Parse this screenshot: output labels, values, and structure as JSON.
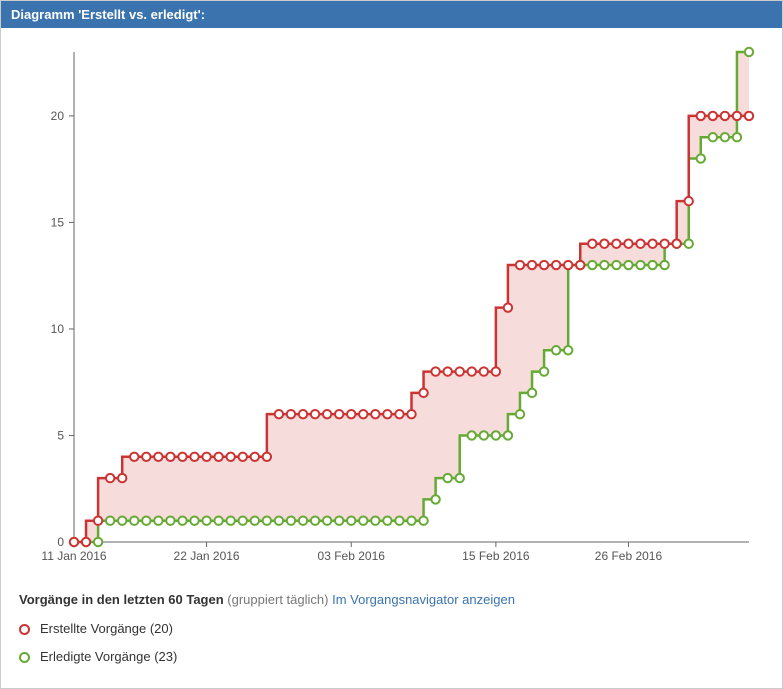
{
  "header": {
    "title": "Diagramm 'Erstellt vs. erledigt':"
  },
  "footer": {
    "line1_bold": "Vorgänge in den letzten 60 Tagen",
    "line1_muted": "(gruppiert täglich)",
    "link_text": "Im Vorgangsnavigator anzeigen",
    "legend_created": "Erstellte Vorgänge (20)",
    "legend_resolved": "Erledigte Vorgänge (23)"
  },
  "chart_data": {
    "type": "line",
    "title": "Erstellt vs. erledigt",
    "xlabel": "",
    "ylabel": "",
    "ylim": [
      0,
      23
    ],
    "y_ticks": [
      0,
      5,
      10,
      15,
      20
    ],
    "x_tick_labels": [
      "11 Jan 2016",
      "22 Jan 2016",
      "03 Feb 2016",
      "15 Feb 2016",
      "26 Feb 2016"
    ],
    "x_tick_index": [
      0,
      11,
      23,
      35,
      46
    ],
    "categories_count": 57,
    "series": [
      {
        "name": "Erstellte Vorgänge",
        "color": "#cc3333",
        "fill_between": true,
        "values": [
          0,
          0,
          1,
          3,
          3,
          4,
          4,
          4,
          4,
          4,
          4,
          4,
          4,
          4,
          4,
          4,
          4,
          6,
          6,
          6,
          6,
          6,
          6,
          6,
          6,
          6,
          6,
          6,
          6,
          7,
          8,
          8,
          8,
          8,
          8,
          8,
          11,
          13,
          13,
          13,
          13,
          13,
          13,
          14,
          14,
          14,
          14,
          14,
          14,
          14,
          14,
          16,
          20,
          20,
          20,
          20,
          20
        ]
      },
      {
        "name": "Erledigte Vorgänge",
        "color": "#66aa33",
        "fill_between": false,
        "values": [
          0,
          0,
          0,
          1,
          1,
          1,
          1,
          1,
          1,
          1,
          1,
          1,
          1,
          1,
          1,
          1,
          1,
          1,
          1,
          1,
          1,
          1,
          1,
          1,
          1,
          1,
          1,
          1,
          1,
          1,
          2,
          3,
          3,
          5,
          5,
          5,
          5,
          6,
          7,
          8,
          9,
          9,
          13,
          13,
          13,
          13,
          13,
          13,
          13,
          13,
          14,
          14,
          18,
          19,
          19,
          19,
          23
        ]
      }
    ]
  }
}
